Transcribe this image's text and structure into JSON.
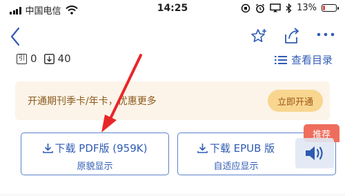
{
  "status_bar": {
    "carrier": "中国电信",
    "time": "14:25",
    "battery_percent": "13%",
    "battery_level": 0.13
  },
  "nav": {
    "back_icon": "chevron-left-icon",
    "star_icon": "star-plus-icon",
    "share_icon": "share-icon",
    "more_icon": "more-dots-icon"
  },
  "stats": {
    "cite_icon": "引",
    "cite_count": "0",
    "download_count": "40",
    "toc_label": "查看目录"
  },
  "promo": {
    "text": "开通期刊季卡/年卡，优惠更多",
    "button_label": "立即开通"
  },
  "downloads": {
    "pdf_title": "下载 PDF版 (959K)",
    "pdf_sub": "原貌显示",
    "epub_title": "下载 EPUB 版",
    "epub_sub": "自适应显示",
    "badge": "推荐"
  },
  "colors": {
    "accent": "#2f5bb3",
    "promo_bg": "#fcf4e8",
    "promo_button": "#f8d690",
    "badge": "#ef6d5d",
    "annotation_arrow": "#e8262a"
  }
}
